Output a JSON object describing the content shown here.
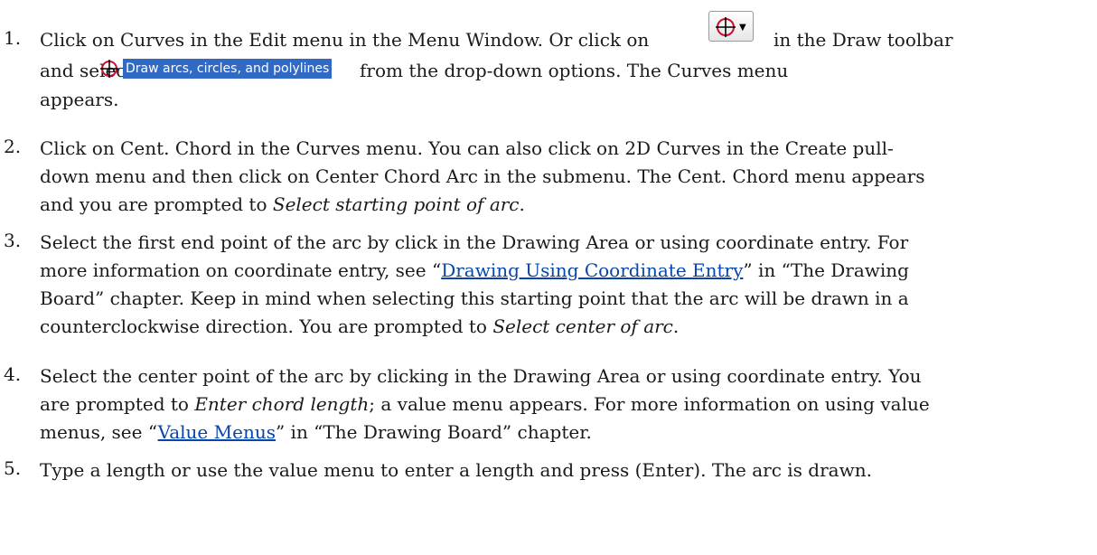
{
  "steps": [
    {
      "number": "1.",
      "line1_a": "Click on Curves in the Edit menu in the Menu Window. Or click on",
      "line1_b": "in the Draw toolbar",
      "line2_a": "and select",
      "option_label": "Draw arcs, circles, and polylines",
      "line2_b": "from the drop-down options. The Curves menu",
      "line3": "appears."
    },
    {
      "number": "2.",
      "line1": "Click on Cent. Chord in the Curves menu. You can also click on 2D Curves in the Create pull-",
      "line2": "down menu and then click on Center Chord Arc in the submenu. The Cent. Chord menu appears",
      "line3_a": "and you are prompted to ",
      "line3_em": "Select starting point of arc",
      "line3_b": "."
    },
    {
      "number": "3.",
      "line1": "Select the first end point of the arc by click in the Drawing Area or using coordinate entry. For",
      "line2_a": "more information on coordinate entry, see “",
      "line2_link": "Drawing Using Coordinate Entry",
      "line2_b": "” in “The Drawing",
      "line3": "Board” chapter. Keep in mind when selecting this starting point that the arc will be drawn in a",
      "line4_a": "counterclockwise direction. You are prompted to ",
      "line4_em": "Select center of arc",
      "line4_b": "."
    },
    {
      "number": "4.",
      "line1": "Select the center point of the arc by clicking in the Drawing Area or using coordinate entry. You",
      "line2_a": "are prompted to ",
      "line2_em": "Enter chord length",
      "line2_b": "; a value menu appears. For more information on using value",
      "line3_a": "menus, see “",
      "line3_link": "Value Menus",
      "line3_b": "” in “The Drawing Board” chapter."
    },
    {
      "number": "5.",
      "line1": "Type a length or use the value menu to enter a length and press (Enter). The arc is drawn."
    }
  ],
  "icons": {
    "toolbar_button": "draw-curves-icon",
    "option_icon": "circle-crosshair-icon"
  },
  "colors": {
    "highlight": "#316ac5",
    "link": "#0645ad",
    "icon_red": "#c8102e"
  }
}
